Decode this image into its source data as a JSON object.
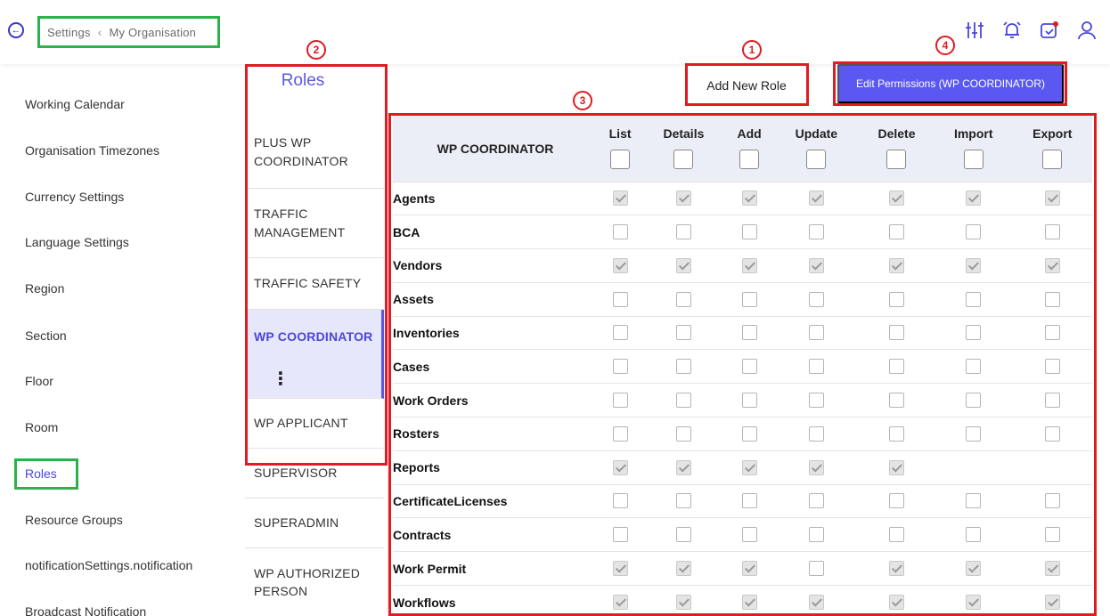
{
  "header": {
    "breadcrumb": [
      "Settings",
      "My Organisation"
    ],
    "icons": [
      "sliders-icon",
      "alarm-bell-icon",
      "calendar-check-icon",
      "user-icon"
    ]
  },
  "sidebar": {
    "items": [
      {
        "label": "Working Calendar",
        "active": false
      },
      {
        "label": "Organisation Timezones",
        "active": false
      },
      {
        "label": "Currency Settings",
        "active": false
      },
      {
        "label": "Language Settings",
        "active": false
      },
      {
        "label": "Region",
        "active": false
      },
      {
        "label": "Section",
        "active": false
      },
      {
        "label": "Floor",
        "active": false
      },
      {
        "label": "Room",
        "active": false
      },
      {
        "label": "Roles",
        "active": true
      },
      {
        "label": "Resource Groups",
        "active": false
      },
      {
        "label": "notificationSettings.notification",
        "active": false
      },
      {
        "label": "Broadcast Notification",
        "active": false
      }
    ]
  },
  "roles": {
    "title": "Roles",
    "items": [
      {
        "label": "PLUS WP COORDINATOR",
        "active": false
      },
      {
        "label": "TRAFFIC MANAGEMENT",
        "active": false
      },
      {
        "label": "TRAFFIC SAFETY",
        "active": false
      },
      {
        "label": "WP COORDINATOR",
        "active": true
      },
      {
        "label": "WP APPLICANT",
        "active": false
      },
      {
        "label": "SUPERVISOR",
        "active": false
      },
      {
        "label": "SUPERADMIN",
        "active": false
      },
      {
        "label": "WP AUTHORIZED PERSON",
        "active": false
      }
    ]
  },
  "actions": {
    "add_role": "Add New Role",
    "edit_permissions": "Edit Permissions (WP COORDINATOR)"
  },
  "annotations": [
    "1",
    "2",
    "3",
    "4"
  ],
  "permissions": {
    "role": "WP COORDINATOR",
    "columns": [
      "List",
      "Details",
      "Add",
      "Update",
      "Delete",
      "Import",
      "Export"
    ],
    "rows": [
      {
        "module": "Agents",
        "values": [
          1,
          1,
          1,
          1,
          1,
          1,
          1
        ]
      },
      {
        "module": "BCA",
        "values": [
          0,
          0,
          0,
          0,
          0,
          0,
          0
        ]
      },
      {
        "module": "Vendors",
        "values": [
          1,
          1,
          1,
          1,
          1,
          1,
          1
        ]
      },
      {
        "module": "Assets",
        "values": [
          0,
          0,
          0,
          0,
          0,
          0,
          0
        ]
      },
      {
        "module": "Inventories",
        "values": [
          0,
          0,
          0,
          0,
          0,
          0,
          0
        ]
      },
      {
        "module": "Cases",
        "values": [
          0,
          0,
          0,
          0,
          0,
          0,
          0
        ]
      },
      {
        "module": "Work Orders",
        "values": [
          0,
          0,
          0,
          0,
          0,
          0,
          0
        ]
      },
      {
        "module": "Rosters",
        "values": [
          0,
          0,
          0,
          0,
          0,
          0,
          0
        ]
      },
      {
        "module": "Reports",
        "values": [
          1,
          1,
          1,
          1,
          1,
          null,
          null
        ]
      },
      {
        "module": "CertificateLicenses",
        "values": [
          0,
          0,
          0,
          0,
          0,
          0,
          0
        ]
      },
      {
        "module": "Contracts",
        "values": [
          0,
          0,
          0,
          0,
          0,
          0,
          0
        ]
      },
      {
        "module": "Work Permit",
        "values": [
          1,
          1,
          1,
          0,
          1,
          1,
          1
        ]
      },
      {
        "module": "Workflows",
        "values": [
          1,
          1,
          1,
          1,
          1,
          1,
          1
        ]
      }
    ]
  },
  "colors": {
    "accent": "#5b58f2",
    "annotation_red": "#e11b22",
    "annotation_green": "#2bb34a"
  }
}
